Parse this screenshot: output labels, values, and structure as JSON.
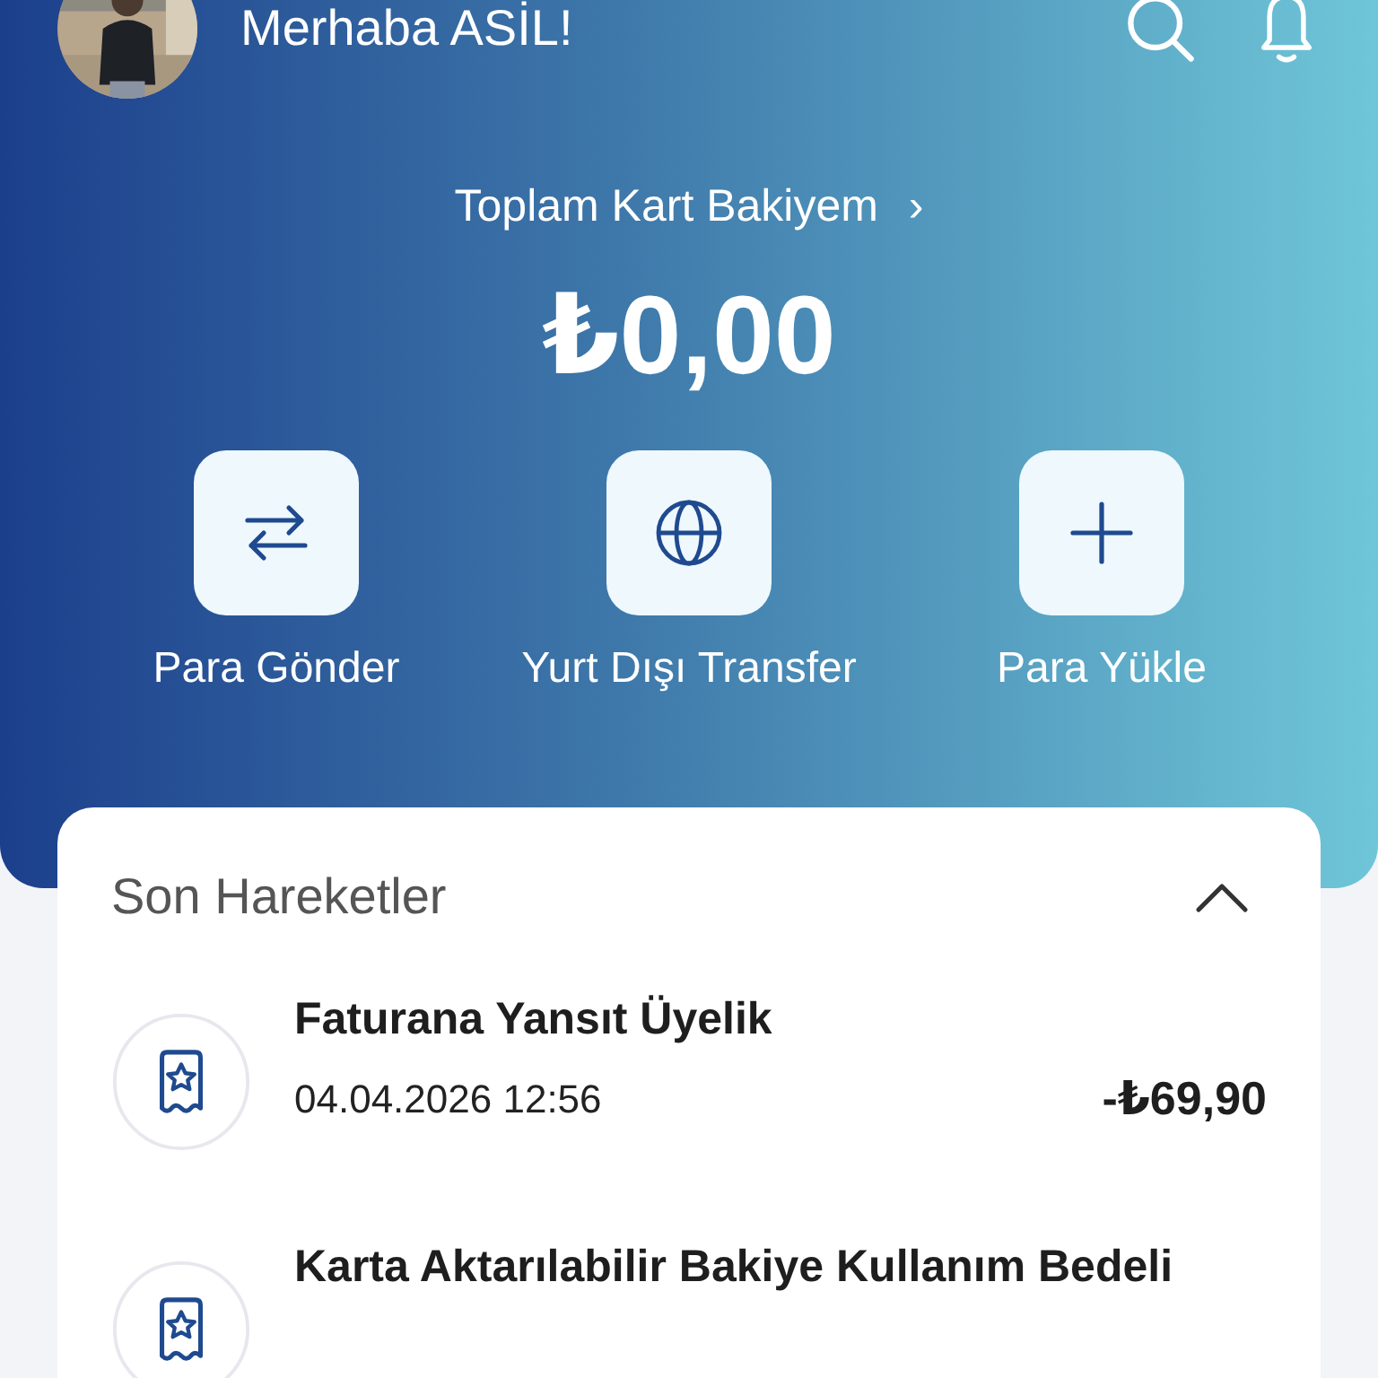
{
  "header": {
    "greeting": "Merhaba ASİL!"
  },
  "balance": {
    "label": "Toplam Kart Bakiyem",
    "chevron": "›",
    "amount": "₺0,00"
  },
  "actions": [
    {
      "kind": "transfer",
      "label": "Para Gönder"
    },
    {
      "kind": "globe",
      "label": "Yurt Dışı Transfer"
    },
    {
      "kind": "plus",
      "label": "Para Yükle"
    }
  ],
  "recent": {
    "title": "Son Hareketler",
    "expanded": true,
    "items": [
      {
        "title": "Faturana Yansıt Üyelik",
        "date": "04.04.2026 12:56",
        "amount": "-₺69,90"
      },
      {
        "title": "Karta Aktarılabilir Bakiye Kullanım Bedeli"
      }
    ]
  }
}
